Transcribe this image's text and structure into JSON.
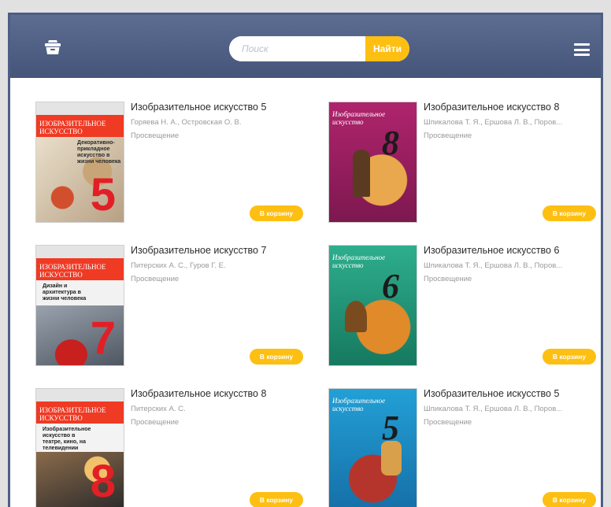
{
  "header": {
    "search_placeholder": "Поиск",
    "search_button": "Найти"
  },
  "books": [
    {
      "title": "Изобразительное искусство 5",
      "authors": "Горяева Н. А., Островская О. В.",
      "publisher": "Просвещение",
      "cart": "В корзину",
      "cover_num": "5",
      "cover_label": "Изобразительное искусство",
      "cover_sub": "Декоративно-прикладное искусство в жизни человека"
    },
    {
      "title": "Изобразительное искусство 8",
      "authors": "Шпикалова Т. Я., Ершова Л. В., Поров...",
      "publisher": "Просвещение",
      "cart": "В корзину",
      "cover_num": "8",
      "cover_label": "Изобразительное искусство"
    },
    {
      "title": "Изобразительное искусство 7",
      "authors": "Питерских А. С., Гуров Г. Е.",
      "publisher": "Просвещение",
      "cart": "В корзину",
      "cover_num": "7",
      "cover_label": "Изобразительное искусство",
      "cover_sub": "Дизайн и архитектура в жизни человека"
    },
    {
      "title": "Изобразительное искусство 6",
      "authors": "Шпикалова Т. Я., Ершова Л. В., Поров...",
      "publisher": "Просвещение",
      "cart": "В корзину",
      "cover_num": "6",
      "cover_label": "Изобразительное искусство"
    },
    {
      "title": "Изобразительное искусство 8",
      "authors": "Питерских А. С.",
      "publisher": "Просвещение",
      "cart": "В корзину",
      "cover_num": "8",
      "cover_label": "Изобразительное искусство",
      "cover_sub": "Изобразительное искусство в театре, кино, на телевидении"
    },
    {
      "title": "Изобразительное искусство 5",
      "authors": "Шпикалова Т. Я., Ершова Л. В., Поров...",
      "publisher": "Просвещение",
      "cart": "В корзину",
      "cover_num": "5",
      "cover_label": "Изобразительное искусство"
    }
  ],
  "colors": {
    "header_top": "#5d6d91",
    "header_bottom": "#455479",
    "accent": "#fdbf12",
    "frame": "#4e5e83"
  }
}
